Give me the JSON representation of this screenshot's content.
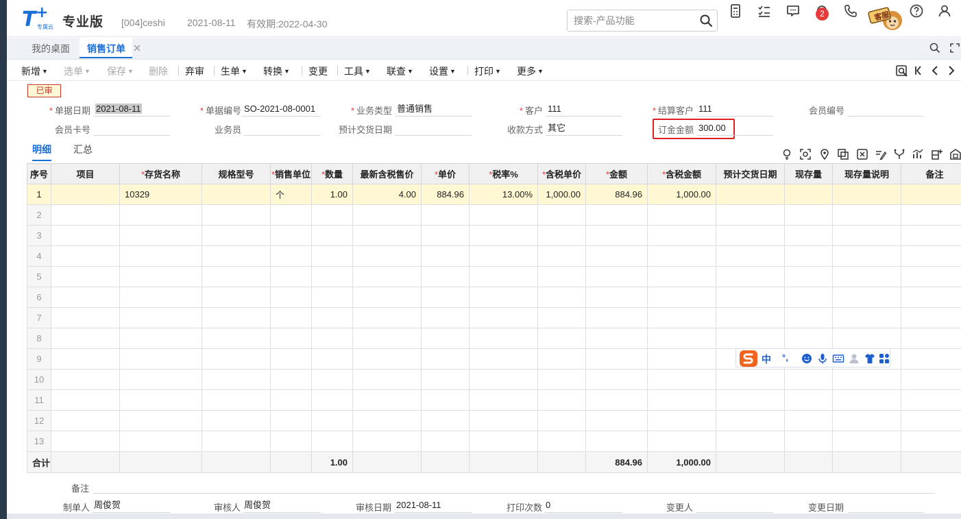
{
  "header": {
    "logo_text": "T+",
    "logo_sub": "专属云",
    "edition": "专业版",
    "account": "[004]ceshi",
    "date": "2021-08-11",
    "validity": "有效期:2022-04-30",
    "search_placeholder": "搜索-产品功能",
    "notification_count": "2",
    "service_label": "客服"
  },
  "tabs": {
    "home": "我的桌面",
    "active": "销售订单"
  },
  "toolbar": {
    "new": "新增",
    "select": "选单",
    "save": "保存",
    "delete": "删除",
    "unaudit": "弃审",
    "generate": "生单",
    "convert": "转换",
    "change": "变更",
    "tools": "工具",
    "related": "联查",
    "settings": "设置",
    "print": "打印",
    "more": "更多"
  },
  "status_stamp": "已审",
  "form": {
    "doc_date_label": "单据日期",
    "doc_date": "2021-08-11",
    "doc_no_label": "单据编号",
    "doc_no": "SO-2021-08-0001",
    "biz_type_label": "业务类型",
    "biz_type": "普通销售",
    "customer_label": "客户",
    "customer": "111",
    "settle_customer_label": "结算客户",
    "settle_customer": "111",
    "member_no_label": "会员编号",
    "member_no": "",
    "member_card_label": "会员卡号",
    "member_card": "",
    "salesperson_label": "业务员",
    "salesperson": "",
    "expected_delivery_label": "预计交货日期",
    "expected_delivery": "",
    "payment_method_label": "收款方式",
    "payment_method": "其它",
    "deposit_amount_label": "订金金额",
    "deposit_amount": "300.00"
  },
  "subtabs": {
    "detail": "明细",
    "summary": "汇总"
  },
  "grid": {
    "headers": [
      "序号",
      "项目",
      "存货名称",
      "规格型号",
      "销售单位",
      "数量",
      "最新含税售价",
      "单价",
      "税率%",
      "含税单价",
      "金额",
      "含税金额",
      "预计交货日期",
      "现存量",
      "现存量说明",
      "备注"
    ],
    "rows": [
      [
        "1",
        "",
        "10329",
        "",
        "个",
        "1.00",
        "4.00",
        "884.96",
        "13.00%",
        "1,000.00",
        "884.96",
        "1,000.00",
        "",
        "",
        "",
        ""
      ],
      [
        "2",
        "",
        "",
        "",
        "",
        "",
        "",
        "",
        "",
        "",
        "",
        "",
        "",
        "",
        "",
        ""
      ],
      [
        "3",
        "",
        "",
        "",
        "",
        "",
        "",
        "",
        "",
        "",
        "",
        "",
        "",
        "",
        "",
        ""
      ],
      [
        "4",
        "",
        "",
        "",
        "",
        "",
        "",
        "",
        "",
        "",
        "",
        "",
        "",
        "",
        "",
        ""
      ],
      [
        "5",
        "",
        "",
        "",
        "",
        "",
        "",
        "",
        "",
        "",
        "",
        "",
        "",
        "",
        "",
        ""
      ],
      [
        "6",
        "",
        "",
        "",
        "",
        "",
        "",
        "",
        "",
        "",
        "",
        "",
        "",
        "",
        "",
        ""
      ],
      [
        "7",
        "",
        "",
        "",
        "",
        "",
        "",
        "",
        "",
        "",
        "",
        "",
        "",
        "",
        "",
        ""
      ],
      [
        "8",
        "",
        "",
        "",
        "",
        "",
        "",
        "",
        "",
        "",
        "",
        "",
        "",
        "",
        "",
        ""
      ],
      [
        "9",
        "",
        "",
        "",
        "",
        "",
        "",
        "",
        "",
        "",
        "",
        "",
        "",
        "",
        "",
        ""
      ],
      [
        "10",
        "",
        "",
        "",
        "",
        "",
        "",
        "",
        "",
        "",
        "",
        "",
        "",
        "",
        "",
        ""
      ],
      [
        "11",
        "",
        "",
        "",
        "",
        "",
        "",
        "",
        "",
        "",
        "",
        "",
        "",
        "",
        "",
        ""
      ],
      [
        "12",
        "",
        "",
        "",
        "",
        "",
        "",
        "",
        "",
        "",
        "",
        "",
        "",
        "",
        "",
        ""
      ],
      [
        "13",
        "",
        "",
        "",
        "",
        "",
        "",
        "",
        "",
        "",
        "",
        "",
        "",
        "",
        "",
        ""
      ]
    ],
    "total_label": "合计",
    "total_quantity": "1.00",
    "total_amount": "884.96",
    "total_amount_tax": "1,000.00"
  },
  "ime": {
    "lang": "中",
    "punct": "°,"
  },
  "footer": {
    "remark_label": "备注",
    "remark": "",
    "maker_label": "制单人",
    "maker": "周俊贺",
    "auditor_label": "审核人",
    "auditor": "周俊贺",
    "audit_date_label": "审核日期",
    "audit_date": "2021-08-11",
    "print_count_label": "打印次数",
    "print_count": "0",
    "changer_label": "变更人",
    "changer": "",
    "change_date_label": "变更日期",
    "change_date": ""
  }
}
